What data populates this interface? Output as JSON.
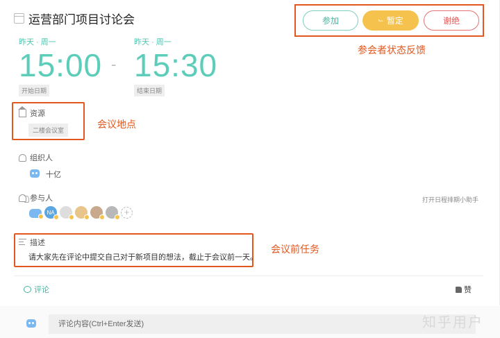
{
  "header": {
    "title": "运营部门项目讨论会"
  },
  "status_buttons": {
    "join": "参加",
    "tentative": "暂定",
    "tentative_prefix": "⌙",
    "decline": "谢绝"
  },
  "annotations": {
    "status": "参会者状态反馈",
    "location": "会议地点",
    "description": "会议前任务"
  },
  "time": {
    "start": {
      "day": "昨天 · 周一",
      "time": "15:00",
      "tag": "开始日期"
    },
    "separator": "-",
    "end": {
      "day": "昨天 · 周一",
      "time": "15:30",
      "tag": "结束日期"
    }
  },
  "resource": {
    "label": "资源",
    "room": "二楼会议室"
  },
  "organizer": {
    "label": "组织人",
    "name": "十亿"
  },
  "attendees": {
    "label": "参与人",
    "initials_na": "NA",
    "add": "+",
    "assistant_link": "打开日程排期小助手"
  },
  "description": {
    "label": "描述",
    "text": "请大家先在评论中提交自己对于新项目的想法，截止于会议前一天。"
  },
  "footer_actions": {
    "comment": "评论",
    "like": "赞"
  },
  "comment_box": {
    "placeholder": "评论内容(Ctrl+Enter发送)"
  },
  "watermark": "知乎用户",
  "colors": {
    "accent": "#5ccdb9",
    "annotation": "#e2571e",
    "tentative": "#f5c34d",
    "decline": "#e05858"
  }
}
